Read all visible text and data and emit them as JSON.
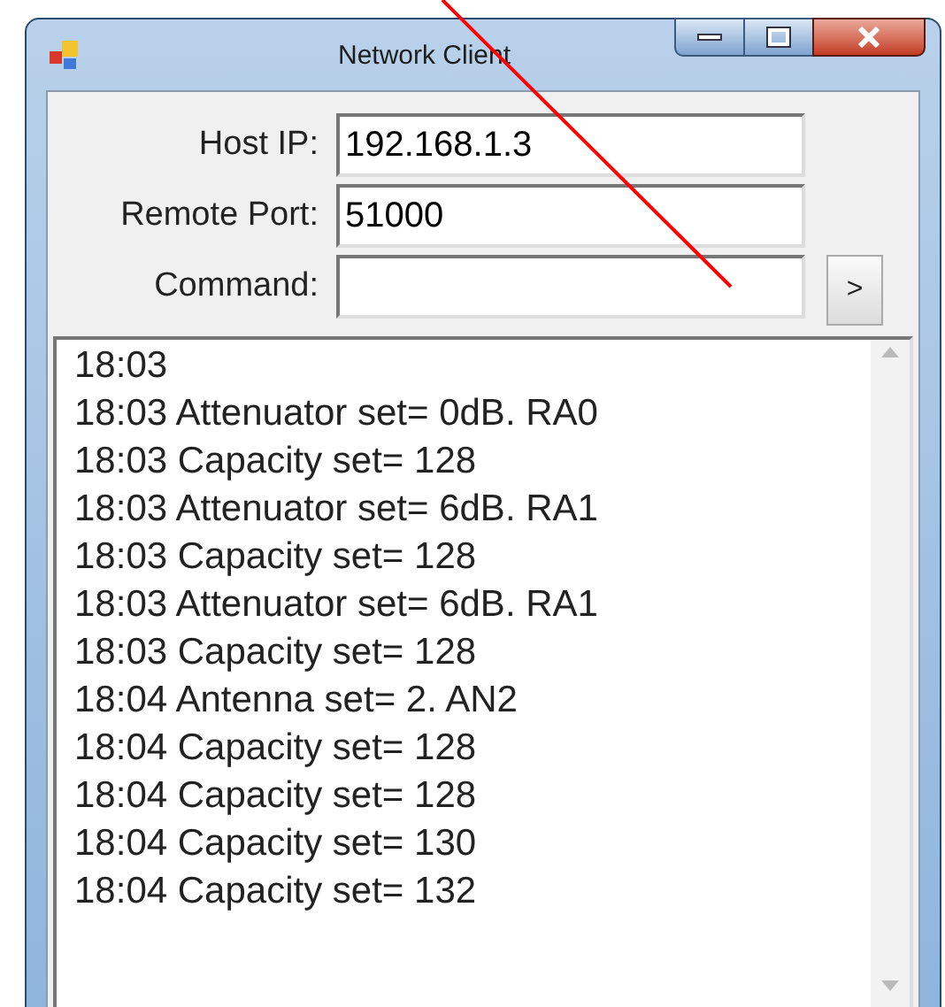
{
  "window": {
    "title": "Network Client"
  },
  "fields": [
    {
      "label": "Host IP:",
      "value": "192.168.1.3"
    },
    {
      "label": "Remote Port:",
      "value": "51000"
    },
    {
      "label": "Command:",
      "button": ">"
    }
  ],
  "log": [
    "18:03",
    "18:03 Attenuator set= 0dB. RA0",
    "18:03 Capacity set= 128",
    "18:03 Attenuator set= 6dB. RA1",
    "18:03 Capacity set= 128",
    "18:03 Attenuator set= 6dB. RA1",
    "18:03 Capacity set= 128",
    "18:04 Antenna set= 2. AN2",
    "18:04 Capacity set= 128",
    "18:04 Capacity set= 128",
    "18:04 Capacity set= 130",
    "18:04 Capacity set= 132"
  ]
}
